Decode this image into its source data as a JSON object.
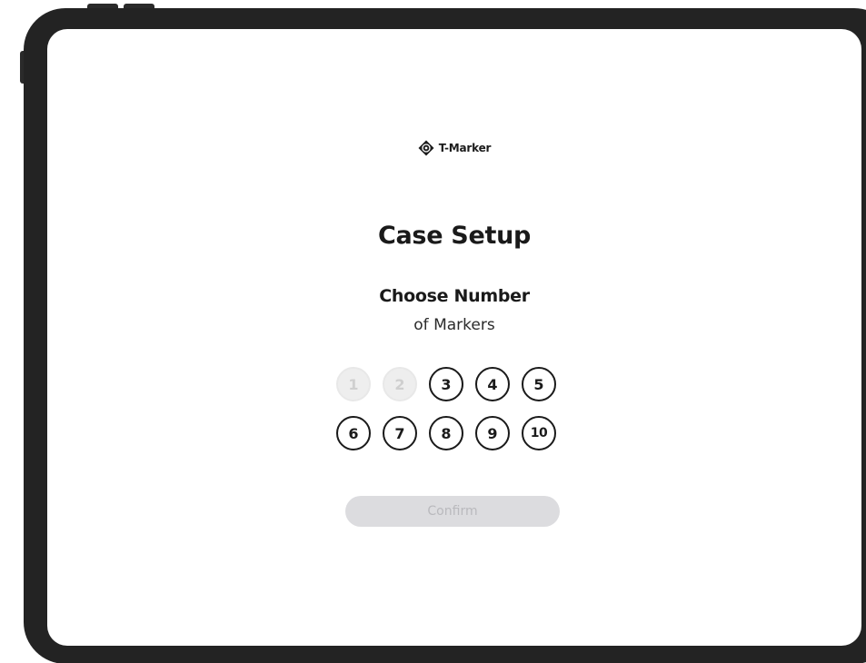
{
  "app": {
    "brand_name": "T-Marker",
    "logo_icon": "diamond-logo-icon"
  },
  "setup": {
    "title": "Case Setup",
    "subtitle_strong": "Choose Number",
    "subtitle_light": "of Markers"
  },
  "markers": {
    "row1": [
      {
        "label": "1",
        "state": "disabled"
      },
      {
        "label": "2",
        "state": "disabled"
      },
      {
        "label": "3",
        "state": "enabled"
      },
      {
        "label": "4",
        "state": "enabled"
      },
      {
        "label": "5",
        "state": "enabled"
      }
    ],
    "row2": [
      {
        "label": "6",
        "state": "enabled"
      },
      {
        "label": "7",
        "state": "enabled"
      },
      {
        "label": "8",
        "state": "enabled"
      },
      {
        "label": "9",
        "state": "enabled"
      },
      {
        "label": "10",
        "state": "enabled"
      }
    ]
  },
  "confirm": {
    "label": "Confirm",
    "state": "disabled"
  },
  "colors": {
    "bezel": "#232323",
    "text_primary": "#1a1a1a",
    "disabled_fill": "#eeeeee",
    "disabled_text": "#cfcfcf",
    "confirm_fill": "#dcdcdf",
    "confirm_text": "#b9b9bd"
  }
}
